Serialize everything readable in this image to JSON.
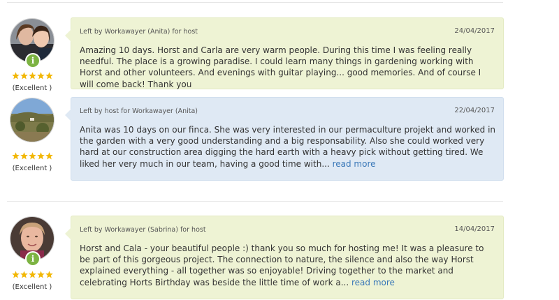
{
  "reviews": [
    {
      "author_line": "Left by Workawayer (Anita) for host",
      "date": "24/04/2017",
      "text": "Amazing 10 days. Horst and Carla are very warm people. During this time I was feeling really needful. The place is a growing paradise. I could learn many things in gardening working with Horst and other volunteers. And evenings with guitar playing... good memories. And of course I will come back! Thank you",
      "read_more": "",
      "rating_label": "(Excellent )",
      "stars": 5,
      "avatar": "two-women-photo",
      "verified_icon": "info-icon",
      "verified_glyph": "i",
      "bubble_color": "#eef3d4"
    },
    {
      "author_line": "Left by host for Workawayer (Anita)",
      "date": "22/04/2017",
      "text": "Anita was 10 days on our finca. She was very interested in our permaculture projekt and worked in the garden with a very good understanding and a big responsability. Also she could worked very hard at our construction area digging the hard earth with a heavy pick without getting tired. We liked her very much in our team, having a good time with...",
      "read_more": "read more",
      "rating_label": "(Excellent )",
      "stars": 5,
      "avatar": "finca-landscape-photo",
      "bubble_color": "#dfe9f4"
    },
    {
      "author_line": "Left by Workawayer (Sabrina) for host",
      "date": "14/04/2017",
      "text": "Horst and Cala - your beautiful people :) thank you so much for hosting me! It was a pleasure to be part of this gorgeous project. The connection to nature, the silence and also the way Horst explained everything - all together was so enjoyable! Driving together to the market and celebrating Horts Birthday was beside the little time of work a...",
      "read_more": "read more",
      "rating_label": "(Excellent )",
      "stars": 5,
      "avatar": "woman-portrait-photo",
      "verified_icon": "info-icon",
      "verified_glyph": "i",
      "bubble_color": "#eef3d4"
    }
  ],
  "colors": {
    "accent_link": "#3a78b8",
    "star": "#f2b705",
    "badge": "#7cb342"
  }
}
